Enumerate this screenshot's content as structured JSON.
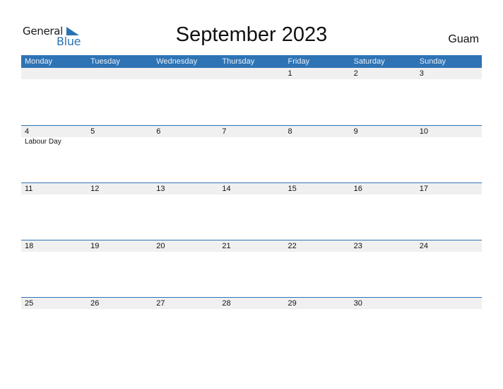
{
  "logo": {
    "word1": "General",
    "word2": "Blue"
  },
  "title": "September 2023",
  "region": "Guam",
  "colors": {
    "header": "#2e74b5",
    "band": "#f0f0f0",
    "logo_blue": "#2b72b3"
  },
  "weekdays": [
    "Monday",
    "Tuesday",
    "Wednesday",
    "Thursday",
    "Friday",
    "Saturday",
    "Sunday"
  ],
  "weeks": [
    {
      "days": [
        "",
        "",
        "",
        "",
        "1",
        "2",
        "3"
      ],
      "events": [
        "",
        "",
        "",
        "",
        "",
        "",
        ""
      ]
    },
    {
      "days": [
        "4",
        "5",
        "6",
        "7",
        "8",
        "9",
        "10"
      ],
      "events": [
        "Labour Day",
        "",
        "",
        "",
        "",
        "",
        ""
      ]
    },
    {
      "days": [
        "11",
        "12",
        "13",
        "14",
        "15",
        "16",
        "17"
      ],
      "events": [
        "",
        "",
        "",
        "",
        "",
        "",
        ""
      ]
    },
    {
      "days": [
        "18",
        "19",
        "20",
        "21",
        "22",
        "23",
        "24"
      ],
      "events": [
        "",
        "",
        "",
        "",
        "",
        "",
        ""
      ]
    },
    {
      "days": [
        "25",
        "26",
        "27",
        "28",
        "29",
        "30",
        ""
      ],
      "events": [
        "",
        "",
        "",
        "",
        "",
        "",
        ""
      ]
    }
  ]
}
